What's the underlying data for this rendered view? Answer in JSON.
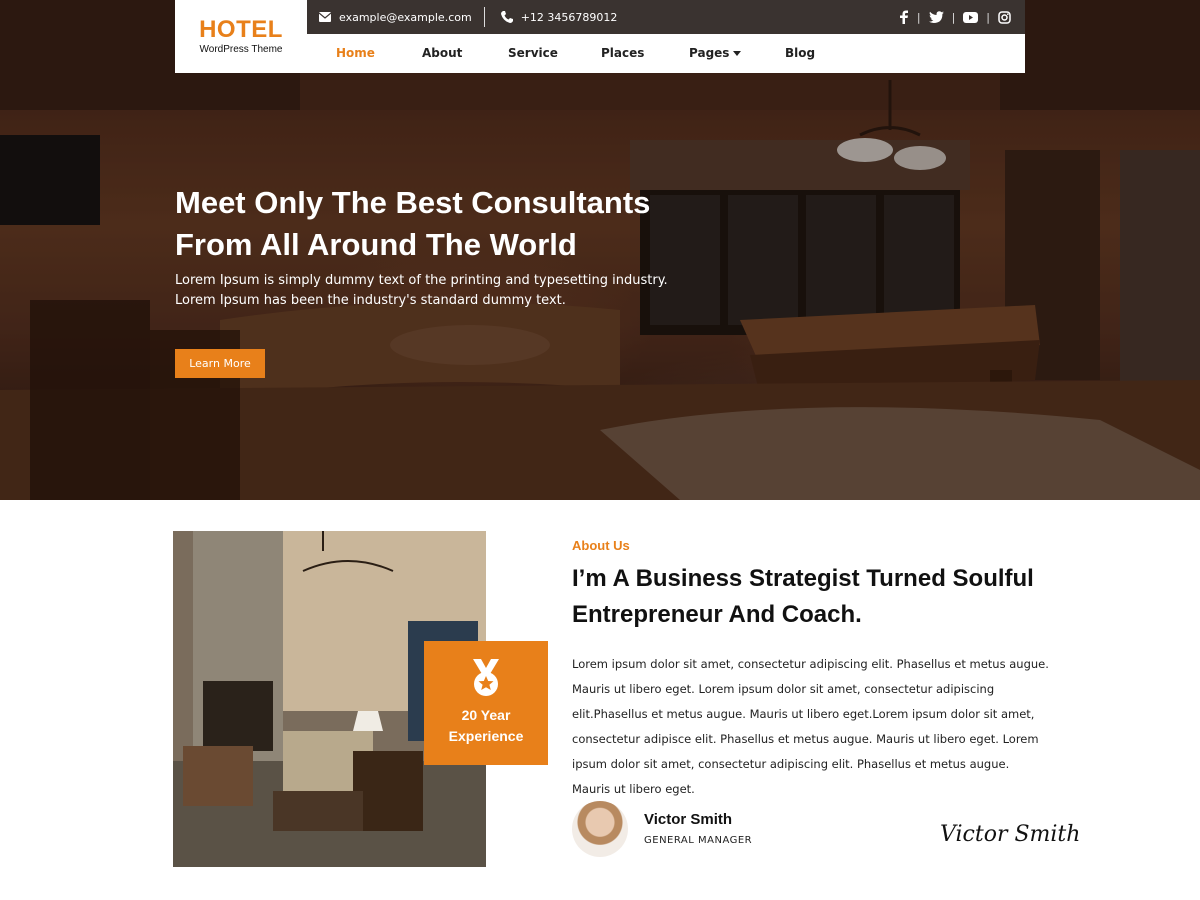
{
  "brand": {
    "name": "HOTEL",
    "tagline": "WordPress Theme",
    "accent": "#e8801a"
  },
  "topbar": {
    "email": "example@example.com",
    "phone": "+12 3456789012",
    "socials": [
      "facebook-icon",
      "twitter-icon",
      "youtube-icon",
      "instagram-icon"
    ]
  },
  "nav": {
    "items": [
      {
        "label": "Home",
        "active": true
      },
      {
        "label": "About"
      },
      {
        "label": "Service"
      },
      {
        "label": "Places"
      },
      {
        "label": "Pages",
        "has_dropdown": true
      },
      {
        "label": "Blog"
      }
    ]
  },
  "hero": {
    "title_line1": "Meet Only The Best Consultants",
    "title_line2": "From All Around The World",
    "subtitle_line1": "Lorem Ipsum is simply dummy text of the printing and typesetting industry.",
    "subtitle_line2": "Lorem Ipsum has been the industry's standard dummy text.",
    "button_label": "Learn More"
  },
  "about": {
    "eyebrow": "About Us",
    "heading_line1": "I’m A Business Strategist Turned Soulful",
    "heading_line2": "Entrepreneur And Coach.",
    "body": "Lorem ipsum dolor sit amet, consectetur adipiscing elit. Phasellus et metus augue. Mauris ut libero eget. Lorem ipsum dolor sit amet, consectetur adipiscing elit.Phasellus et metus augue. Mauris ut libero eget.Lorem ipsum dolor sit amet, consectetur adipisce elit. Phasellus et metus augue. Mauris ut libero eget. Lorem ipsum dolor sit amet, consectetur adipiscing elit. Phasellus et metus augue. Mauris ut libero eget.",
    "experience_line1": "20 Year",
    "experience_line2": "Experience",
    "person_name": "Victor Smith",
    "person_role": "GENERAL MANAGER",
    "signature": "Victor Smith"
  }
}
